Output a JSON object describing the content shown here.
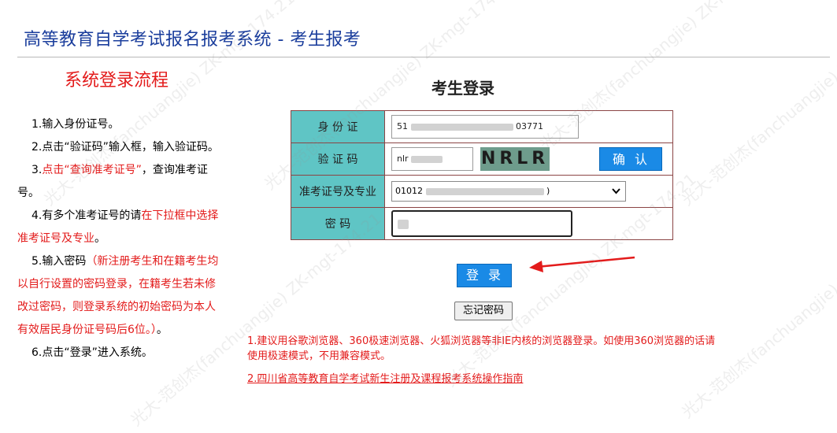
{
  "header": {
    "title": "高等教育自学考试报名报考系统 - 考生报考"
  },
  "flow": {
    "title": "系统登录流程",
    "steps": [
      {
        "parts": [
          {
            "text": "1.输入身份证号。",
            "red": false
          }
        ]
      },
      {
        "parts": [
          {
            "text": "2.点击“验证码”输入框，输入验证码。",
            "red": false
          }
        ]
      },
      {
        "parts": [
          {
            "text": "3.",
            "red": false
          },
          {
            "text": "点击“查询准考证号”",
            "red": true
          },
          {
            "text": "，查询准考证号。",
            "red": false
          }
        ]
      },
      {
        "parts": [
          {
            "text": "4.有多个准考证号的请",
            "red": false
          },
          {
            "text": "在下拉框中选择准考证号及专业",
            "red": true
          },
          {
            "text": "。",
            "red": false
          }
        ]
      },
      {
        "parts": [
          {
            "text": "5.输入密码",
            "red": false
          },
          {
            "text": "（新注册考生和在籍考生均以自行设置的密码登录，在籍考生若未修改过密码，则登录系统的初始密码为本人有效居民身份证号码后6位。）",
            "red": true
          },
          {
            "text": "。",
            "red": false
          }
        ]
      },
      {
        "parts": [
          {
            "text": "6.点击“登录”进入系统。",
            "red": false
          }
        ]
      }
    ]
  },
  "login": {
    "title": "考生登录",
    "id_label": "身 份 证",
    "id_value_prefix": "51",
    "id_value_suffix": "03771",
    "captcha_label": "验 证 码",
    "captcha_value": "nlr",
    "captcha_text": "NRLR",
    "confirm_label": "确认",
    "exam_label": "准考证号及专业",
    "exam_value_prefix": "01012",
    "exam_value_suffix": ")",
    "password_label": "密 码",
    "login_button": "登录",
    "forgot_button": "忘记密码"
  },
  "notes": {
    "browser_tip": "1.建议用谷歌浏览器、360极速浏览器、火狐浏览器等非IE内核的浏览器登录。如使用360浏览器的话请使用极速模式，不用兼容模式。",
    "guide_link": "2.四川省高等教育自学考试新生注册及课程报考系统操作指南"
  },
  "watermark": {
    "text": "光大-范创杰(fanchuangjie) ZK-mgt-174.21"
  },
  "colors": {
    "title_blue": "#1a3d9c",
    "red": "#e31b1b",
    "label_teal": "#5fc5c5",
    "button_blue": "#1a8ae6"
  },
  "icons": {
    "select_arrow": "chevron-down-icon",
    "pointer_arrow": "red-arrow-icon"
  }
}
